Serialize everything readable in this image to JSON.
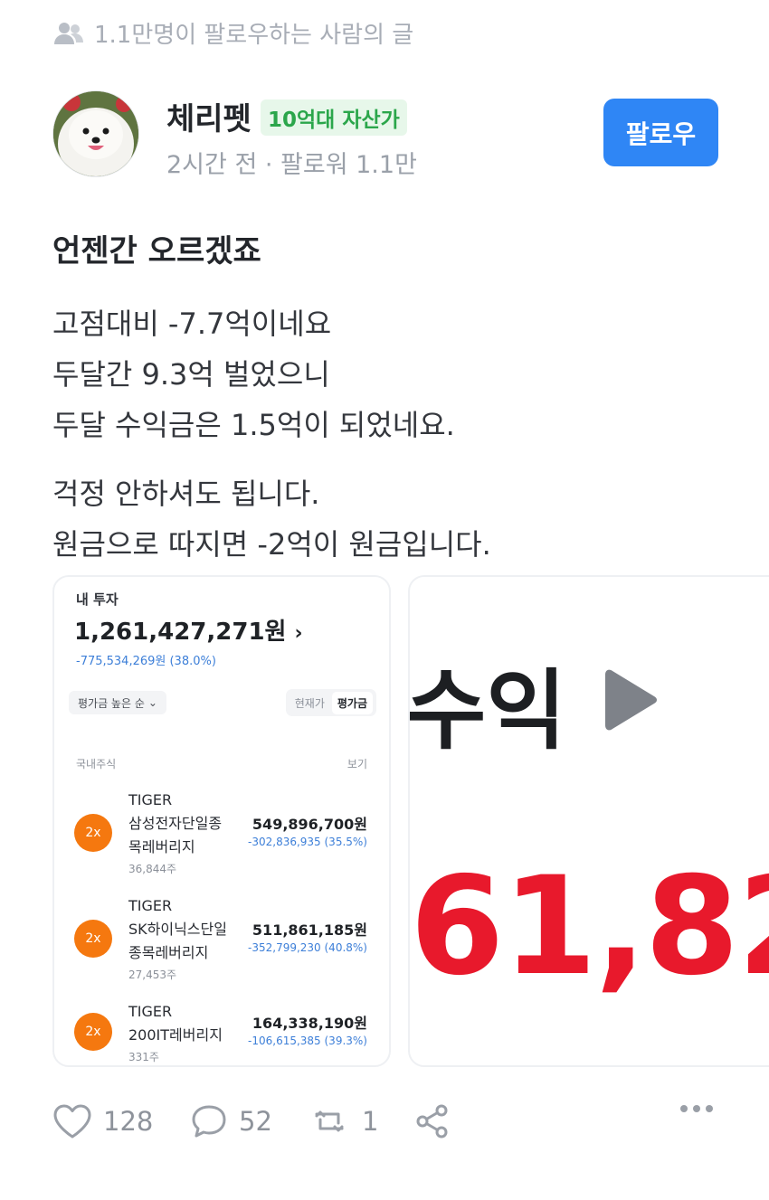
{
  "banner": {
    "text": "1.1만명이 팔로우하는 사람의 글",
    "icon": "users-icon"
  },
  "author": {
    "name": "체리펫",
    "badge": "10억대 자산가",
    "meta": "2시간 전 · 팔로워 1.1만",
    "follow_label": "팔로우"
  },
  "post": {
    "title": "언젠간 오르겠죠",
    "paragraphs": [
      [
        "고점대비 -7.7억이네요",
        "두달간 9.3억 벌었으니",
        "두달 수익금은 1.5억이 되었네요."
      ],
      [
        "걱정 안하셔도 됩니다.",
        "원금으로 따지면 -2억이 원금입니다."
      ]
    ]
  },
  "portfolio": {
    "label": "내 투자",
    "total": "1,261,427,271원",
    "total_change": "-775,534,269원 (38.0%)",
    "sort_label": "평가금 높은 순",
    "segments": [
      "현재가",
      "평가금"
    ],
    "active_segment": "평가금",
    "section": "국내주식",
    "view_label": "보기",
    "holdings": [
      {
        "leverage": "2x",
        "name_lines": [
          "TIGER",
          "삼성전자단일종",
          "목레버리지"
        ],
        "quantity": "36,844주",
        "value": "549,896,700원",
        "change": "-302,836,935 (35.5%)"
      },
      {
        "leverage": "2x",
        "name_lines": [
          "TIGER",
          "SK하이닉스단일",
          "종목레버리지"
        ],
        "quantity": "27,453주",
        "value": "511,861,185원",
        "change": "-352,799,230 (40.8%)"
      },
      {
        "leverage": "2x",
        "name_lines": [
          "TIGER",
          "200IT레버리지"
        ],
        "quantity": "331주",
        "value": "164,338,190원",
        "change": "-106,615,385 (39.3%)"
      }
    ],
    "accent_color": "#3d7fd8",
    "leverage_color": "#f5780f"
  },
  "second_image": {
    "word": "수익",
    "number": "61,82",
    "number_color": "#e8192c"
  },
  "actions": {
    "likes": "128",
    "comments": "52",
    "reposts": "1"
  },
  "colors": {
    "primary": "#2f86f5",
    "badge_bg": "#e7f7ea",
    "badge_text": "#2ba64b"
  }
}
